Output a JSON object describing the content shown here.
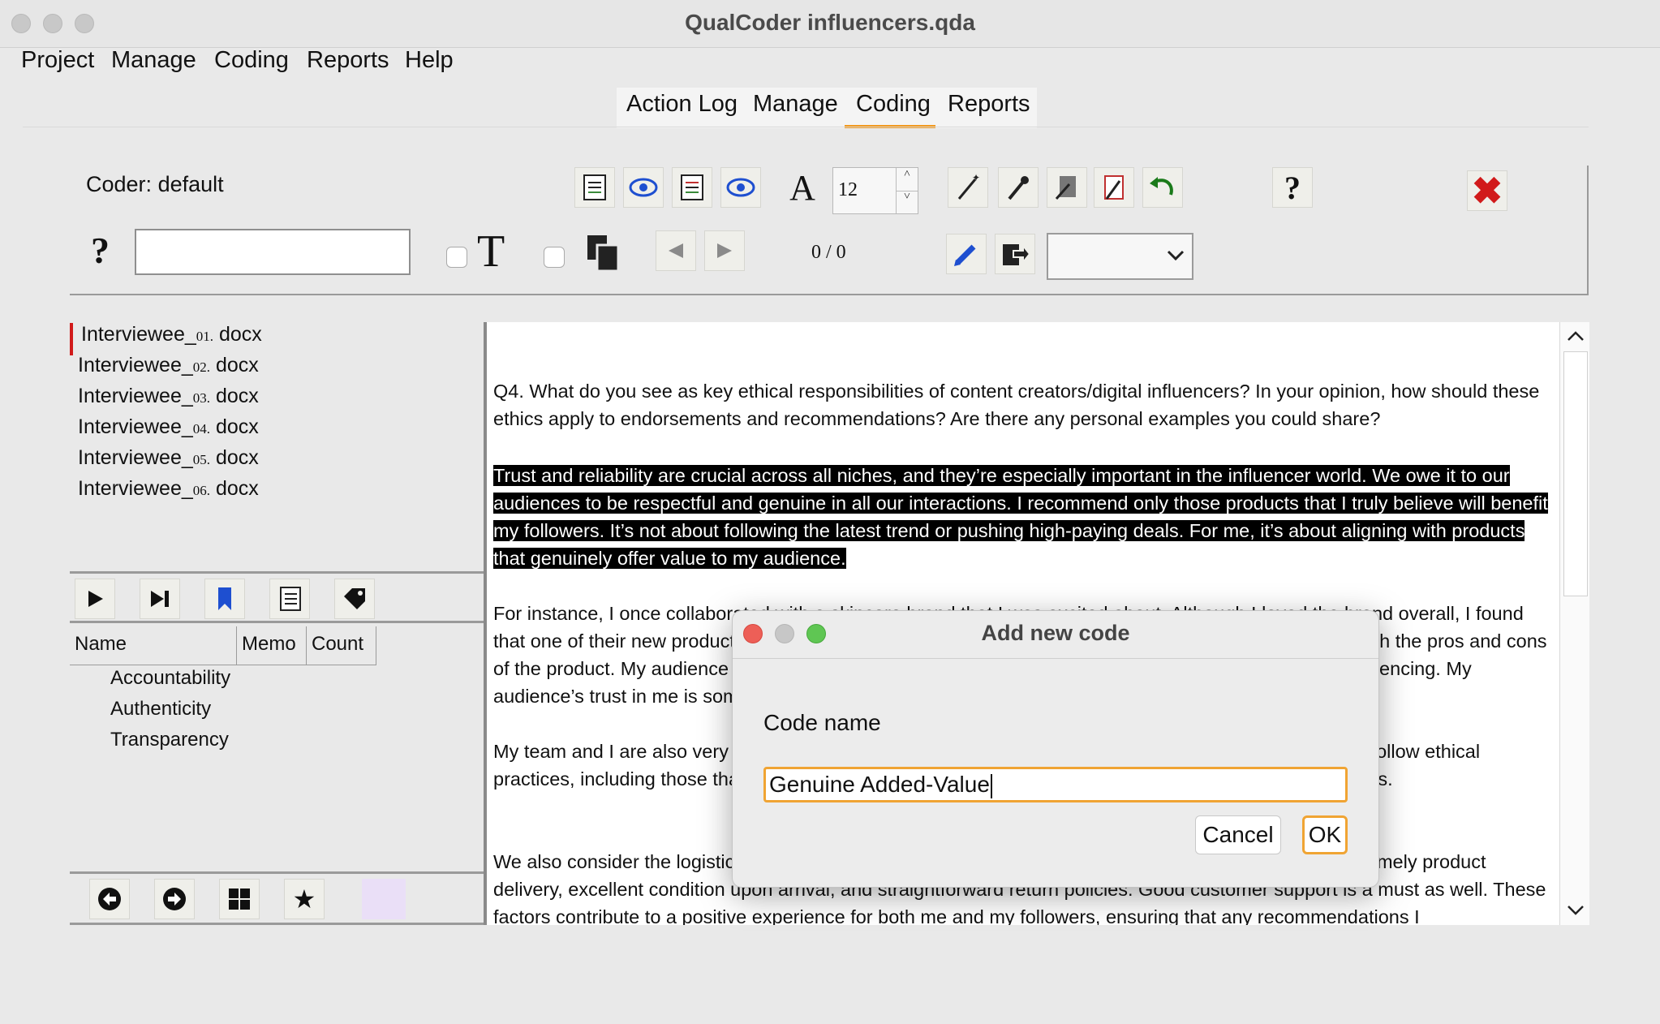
{
  "window": {
    "title": "QualCoder influencers.qda"
  },
  "menubar": [
    "Project",
    "Manage",
    "Coding",
    "Reports",
    "Help"
  ],
  "tabs": [
    "Action Log",
    "Manage",
    "Coding",
    "Reports"
  ],
  "active_tab": "Coding",
  "coder": {
    "label": "Coder:",
    "name": "default"
  },
  "search": {
    "help_label": "?",
    "value": ""
  },
  "font_size": {
    "value": "12",
    "up": "˄",
    "down": "˅"
  },
  "help_button": "?",
  "nav_counter": "0 / 0",
  "files": [
    {
      "prefix": "Interviewee_",
      "num": "01.",
      "ext": " docx"
    },
    {
      "prefix": "Interviewee_",
      "num": "02.",
      "ext": " docx"
    },
    {
      "prefix": "Interviewee_",
      "num": "03.",
      "ext": " docx"
    },
    {
      "prefix": "Interviewee_",
      "num": "04.",
      "ext": " docx"
    },
    {
      "prefix": "Interviewee_",
      "num": "05.",
      "ext": " docx"
    },
    {
      "prefix": "Interviewee_",
      "num": "06.",
      "ext": " docx"
    }
  ],
  "code_tree": {
    "columns": [
      "Name",
      "Memo",
      "Count"
    ],
    "codes": [
      "Accountability",
      "Authenticity",
      "Transparency"
    ]
  },
  "document": {
    "question": "Q4.  What do you see as key ethical responsibilities of content creators/digital influencers? In your opinion, how should these ethics apply to endorsements and recommendations? Are there any personal examples you could share?",
    "highlighted": "Trust and reliability are crucial across all niches, and they’re especially important in the influencer world.  We owe it to our audiences to be respectful and genuine in all our interactions.  I recommend only those products that I truly believe will benefit my followers.  It’s not about following the latest trend or pushing high-paying deals.  For me, it’s about aligning with products that genuinely offer value to my audience.",
    "p3": "For instance, I once collaborated with a skincare brand that I was excited about.  Although I loved the brand overall, I found that one of their new products didn’t meet my expectations.  So I gave it an honest review, highlighting both the pros and cons of the product.  My audience appreciated the transparency and my commitment to honest and ethical influencing.  My audience’s trust in me is something I’ve carefully built.",
    "p4": "My team and I are also very selective about the brands we partner with, and we look for companies that follow ethical practices, including those that do not test on animals and whose values align with ours and our audience’s.",
    "p5": "We also consider the logistics of the brands we work with; we tend to choose brands that are known for timely product delivery, excellent condition upon arrival, and straightforward return policies.  Good customer support is a must as well.  These factors contribute to a positive experience for both me and my followers, ensuring that any recommendations I"
  },
  "dialog": {
    "title": "Add new code",
    "label": "Code name",
    "value": "Genuine Added-Value",
    "cancel": "Cancel",
    "ok": "OK"
  },
  "colors": {
    "accent_orange": "#f29a1f",
    "delete_red": "#d11a1a",
    "highlight_bg": "#000000",
    "mac_close": "#ed5f57",
    "mac_min": "#c7c7c7",
    "mac_zoom": "#5fc653",
    "icon_blue": "#1e4fd0",
    "undo_green": "#1a7a1a",
    "lavender": "#eadff7"
  }
}
